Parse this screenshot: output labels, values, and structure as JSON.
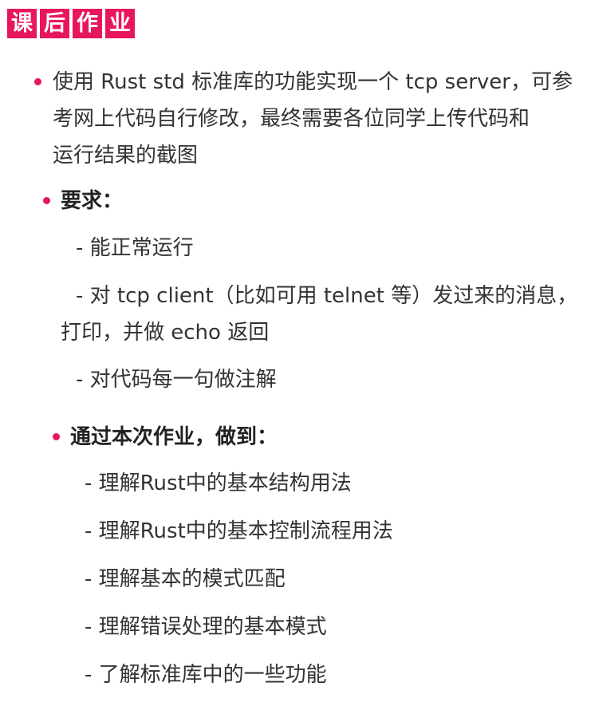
{
  "header": {
    "title_chars": [
      "课",
      "后",
      "作",
      "业"
    ]
  },
  "colors": {
    "accent": "#e8175d",
    "text": "#333333"
  },
  "bullets": [
    {
      "lines": [
        "使用 Rust std 标准库的功能实现一个 tcp server，可参",
        "考网上代码自行修改，最终需要各位同学上传代码和",
        "运行结果的截图"
      ]
    },
    {
      "heading": "要求：",
      "items": [
        "- 能正常运行",
        "- 对 tcp client（比如可用 telnet 等）发过来的消息，",
        "打印，并做 echo 返回",
        "- 对代码每一句做注解"
      ]
    },
    {
      "heading": "通过本次作业，做到：",
      "items": [
        "- 理解Rust中的基本结构用法",
        "- 理解Rust中的基本控制流程用法",
        "- 理解基本的模式匹配",
        "- 理解错误处理的基本模式",
        "- 了解标准库中的一些功能"
      ]
    }
  ]
}
